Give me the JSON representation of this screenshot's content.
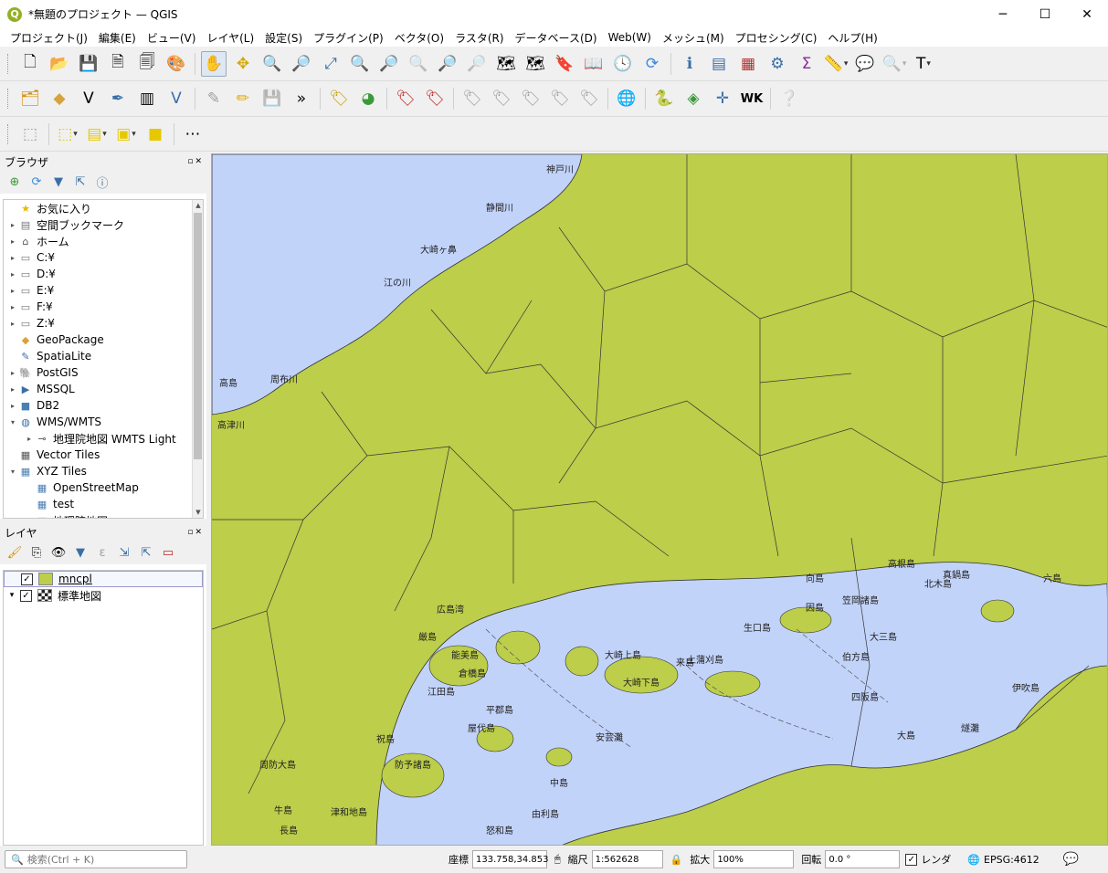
{
  "window": {
    "title": "*無題のプロジェクト — QGIS",
    "app_icon": "Q",
    "minimize": "─",
    "maximize": "☐",
    "close": "✕"
  },
  "menu": [
    "プロジェクト(J)",
    "編集(E)",
    "ビュー(V)",
    "レイヤ(L)",
    "設定(S)",
    "プラグイン(P)",
    "ベクタ(O)",
    "ラスタ(R)",
    "データベース(D)",
    "Web(W)",
    "メッシュ(M)",
    "プロセシング(C)",
    "ヘルプ(H)"
  ],
  "browser": {
    "title": "ブラウザ",
    "title_buttons": "▫✕",
    "items": [
      {
        "arrow": "",
        "icon": "★",
        "label": "お気に入り",
        "color": "#e8b800"
      },
      {
        "arrow": "▸",
        "icon": "▤",
        "label": "空間ブックマーク",
        "color": "#777"
      },
      {
        "arrow": "▸",
        "icon": "⌂",
        "label": "ホーム",
        "color": "#555"
      },
      {
        "arrow": "▸",
        "icon": "▭",
        "label": "C:¥",
        "color": "#777"
      },
      {
        "arrow": "▸",
        "icon": "▭",
        "label": "D:¥",
        "color": "#777"
      },
      {
        "arrow": "▸",
        "icon": "▭",
        "label": "E:¥",
        "color": "#777"
      },
      {
        "arrow": "▸",
        "icon": "▭",
        "label": "F:¥",
        "color": "#777"
      },
      {
        "arrow": "▸",
        "icon": "▭",
        "label": "Z:¥",
        "color": "#777"
      },
      {
        "arrow": "",
        "icon": "◆",
        "label": "GeoPackage",
        "color": "#d7a33b"
      },
      {
        "arrow": "",
        "icon": "✎",
        "label": "SpatiaLite",
        "color": "#3a6ea5"
      },
      {
        "arrow": "▸",
        "icon": "🐘",
        "label": "PostGIS",
        "color": "#336791"
      },
      {
        "arrow": "▸",
        "icon": "▶",
        "label": "MSSQL",
        "color": "#3a6ea5"
      },
      {
        "arrow": "▸",
        "icon": "■",
        "label": "DB2",
        "color": "#4a7fb5"
      },
      {
        "arrow": "▾",
        "icon": "◍",
        "label": "WMS/WMTS",
        "color": "#3a6ea5"
      },
      {
        "arrow": "▸",
        "icon": "⊸",
        "label": "地理院地図 WMTS Light",
        "color": "#555",
        "indent": 1
      },
      {
        "arrow": "",
        "icon": "▦",
        "label": "Vector Tiles",
        "color": "#555"
      },
      {
        "arrow": "▾",
        "icon": "▦",
        "label": "XYZ Tiles",
        "color": "#4a7fb5"
      },
      {
        "arrow": "",
        "icon": "▦",
        "label": "OpenStreetMap",
        "color": "#4a7fb5",
        "indent": 1
      },
      {
        "arrow": "",
        "icon": "▦",
        "label": "test",
        "color": "#4a7fb5",
        "indent": 1
      },
      {
        "arrow": "",
        "icon": "▦",
        "label": "地理院地図",
        "color": "#4a7fb5",
        "indent": 1
      }
    ]
  },
  "layers": {
    "title": "レイヤ",
    "title_buttons": "▫✕",
    "items": [
      {
        "arrow": "",
        "checked": "✓",
        "label": "mncpl",
        "swatch": "#bcce4a",
        "selected": true
      },
      {
        "arrow": "▾",
        "checked": "✓",
        "label": "標準地図",
        "swatch": "checker",
        "selected": false
      }
    ]
  },
  "map": {
    "land": "#bcce4a",
    "sea": "#c2d3fa",
    "labels": [
      "神戸川",
      "静間川",
      "大崎ヶ鼻",
      "江の川",
      "周布川",
      "高島",
      "高津川",
      "広島湾",
      "厳島",
      "倉橋島",
      "能美島",
      "江田島",
      "大崎上島",
      "大崎下島",
      "上蒲刈島",
      "因島",
      "生口島",
      "向島",
      "高根島",
      "四阪島",
      "大三島",
      "伯方島",
      "大島",
      "燧灘",
      "伊吹島",
      "笠岡諸島",
      "北木島",
      "真鍋島",
      "六島",
      "屋代島",
      "平郡島",
      "祝島",
      "牛島",
      "長島",
      "周防大島",
      "中島",
      "由利島",
      "怒和島",
      "津和地島",
      "来島",
      "安芸灘",
      "防予諸島"
    ]
  },
  "status": {
    "search_placeholder": "検索(Ctrl + K)",
    "coord_label": "座標",
    "coord_value": "133.758,34.853",
    "scale_label": "縮尺",
    "scale_value": "1:562628",
    "mag_label": "拡大",
    "mag_value": "100%",
    "rot_label": "回転",
    "rot_value": "0.0 °",
    "render_label": "レンダ",
    "render_checked": "✓",
    "crs": "EPSG:4612"
  }
}
